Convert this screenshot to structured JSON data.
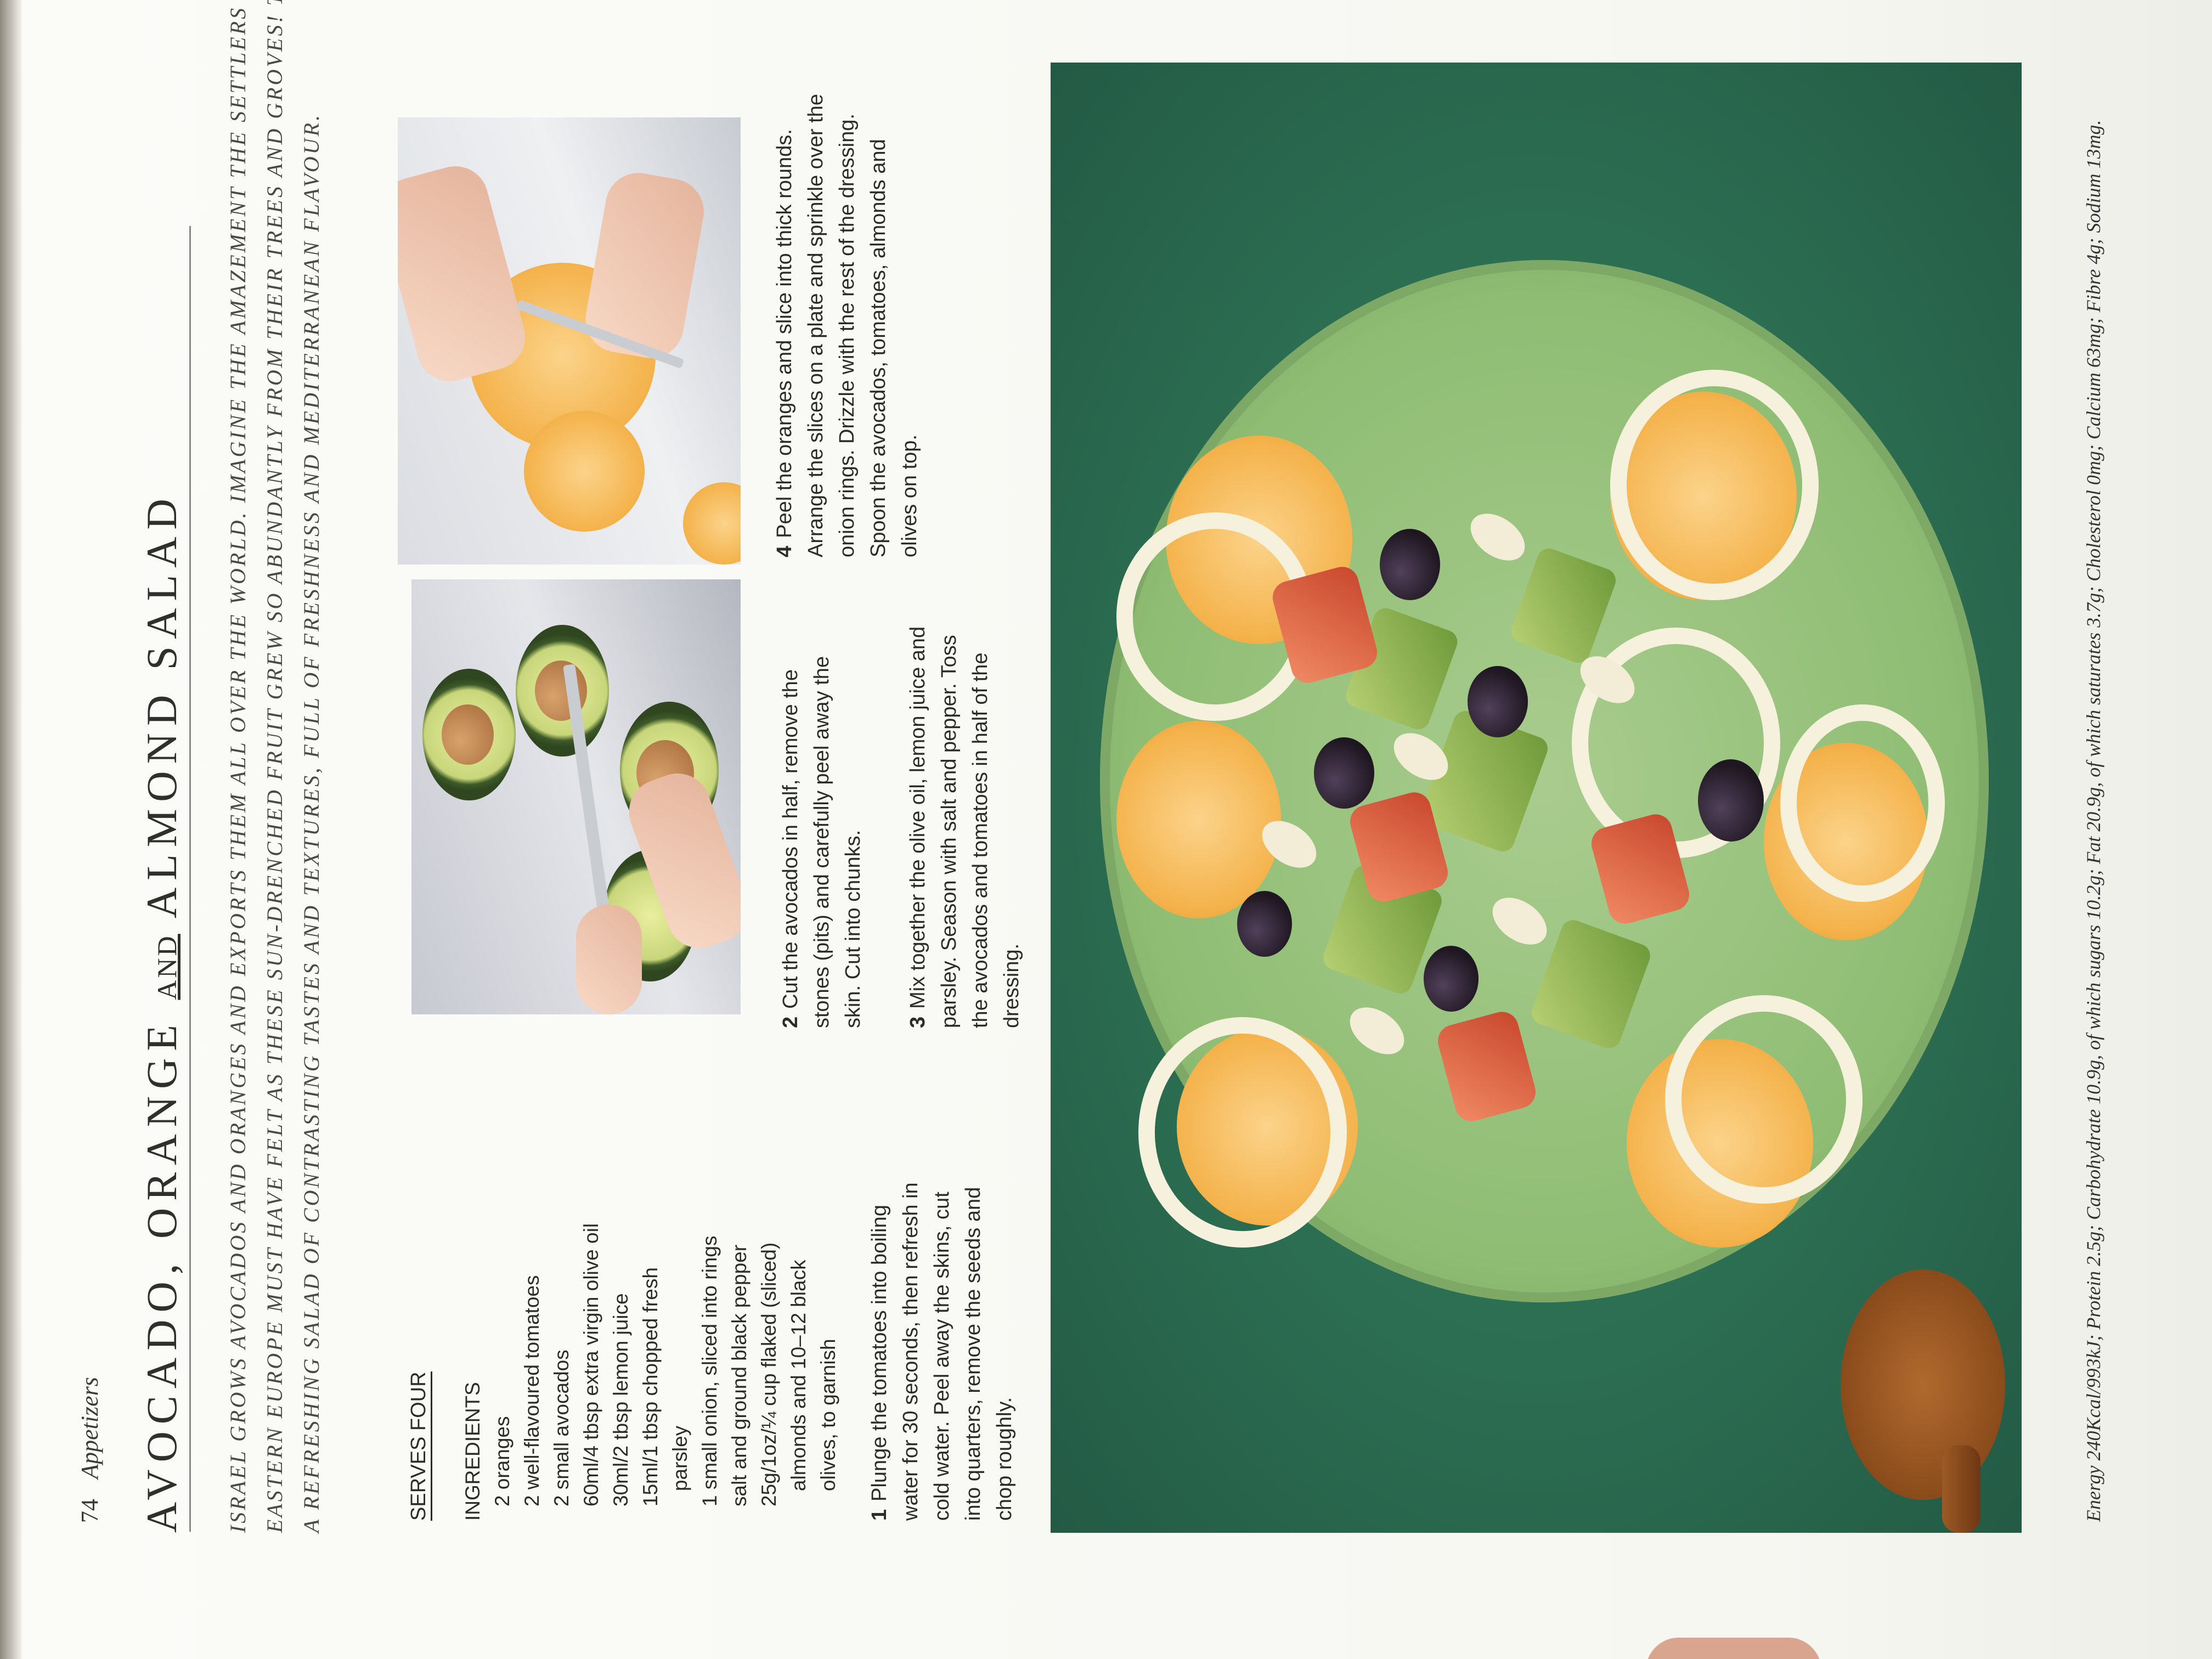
{
  "header": {
    "page_number": "74",
    "section": "Appetizers"
  },
  "title": {
    "part1": "AVOCADO, ORANGE ",
    "and": "AND",
    "part2": " ALMOND SALAD"
  },
  "intro": "Israel grows avocados and oranges and exports them all over the world. Imagine the amazement the settlers from Eastern Europe must have felt as these sun-drenched fruit grew so abundantly from their trees and groves! This is a refreshing salad of contrasting tastes and textures, full of freshness and Mediterranean flavour.",
  "serves": "SERVES FOUR",
  "ingredients": {
    "heading": "INGREDIENTS",
    "items": [
      "2 oranges",
      "2 well-flavoured tomatoes",
      "2 small avocados",
      "60ml/4 tbsp extra virgin olive oil",
      "30ml/2 tbsp lemon juice",
      "15ml/1 tbsp chopped fresh parsley",
      "1 small onion, sliced into rings",
      "salt and ground black pepper",
      "25g/1oz/¼ cup flaked (sliced) almonds and 10–12 black olives, to garnish"
    ]
  },
  "steps": [
    {
      "n": "1",
      "text": "Plunge the tomatoes into boiling water for 30 seconds, then refresh in cold water. Peel away the skins, cut into quarters, remove the seeds and chop roughly."
    },
    {
      "n": "2",
      "text": "Cut the avocados in half, remove the stones (pits) and carefully peel away the skin. Cut into chunks."
    },
    {
      "n": "3",
      "text": "Mix together the olive oil, lemon juice and parsley. Season with salt and pepper. Toss the avocados and tomatoes in half of the dressing."
    },
    {
      "n": "4",
      "text": "Peel the oranges and slice into thick rounds. Arrange the slices on a plate and sprinkle over the onion rings. Drizzle with the rest of the dressing. Spoon the avocados, tomatoes, almonds and olives on top."
    }
  ],
  "nutrition": "Energy 240Kcal/993kJ; Protein 2.5g; Carbohydrate 10.9g, of which sugars 10.2g; Fat 20.9g, of which saturates 3.7g; Cholesterol 0mg; Calcium 63mg; Fibre 4g; Sodium 13mg."
}
